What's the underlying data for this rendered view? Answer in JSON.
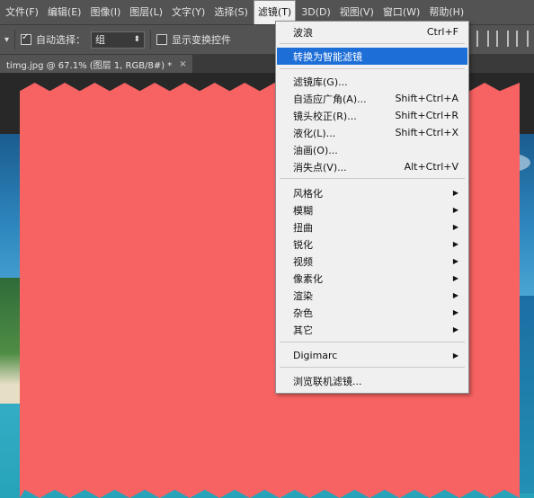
{
  "menubar": {
    "items": [
      {
        "label": "文件(F)"
      },
      {
        "label": "编辑(E)"
      },
      {
        "label": "图像(I)"
      },
      {
        "label": "图层(L)"
      },
      {
        "label": "文字(Y)"
      },
      {
        "label": "选择(S)"
      },
      {
        "label": "滤镜(T)"
      },
      {
        "label": "3D(D)"
      },
      {
        "label": "视图(V)"
      },
      {
        "label": "窗口(W)"
      },
      {
        "label": "帮助(H)"
      }
    ]
  },
  "options": {
    "auto_select_label": "自动选择：",
    "auto_select_value": "组",
    "show_transform_label": "显示变换控件"
  },
  "tab": {
    "title": "timg.jpg @ 67.1% (图层 1, RGB/8#) *",
    "close": "×"
  },
  "filter_menu": {
    "items": [
      {
        "label": "波浪",
        "shortcut": "Ctrl+F"
      },
      {
        "label": "转换为智能滤镜",
        "shortcut": ""
      },
      {
        "label": "滤镜库(G)...",
        "shortcut": ""
      },
      {
        "label": "自适应广角(A)...",
        "shortcut": "Shift+Ctrl+A"
      },
      {
        "label": "镜头校正(R)...",
        "shortcut": "Shift+Ctrl+R"
      },
      {
        "label": "液化(L)...",
        "shortcut": "Shift+Ctrl+X"
      },
      {
        "label": "油画(O)...",
        "shortcut": ""
      },
      {
        "label": "消失点(V)...",
        "shortcut": "Alt+Ctrl+V"
      },
      {
        "label": "风格化",
        "shortcut": ""
      },
      {
        "label": "模糊",
        "shortcut": ""
      },
      {
        "label": "扭曲",
        "shortcut": ""
      },
      {
        "label": "锐化",
        "shortcut": ""
      },
      {
        "label": "视频",
        "shortcut": ""
      },
      {
        "label": "像素化",
        "shortcut": ""
      },
      {
        "label": "渲染",
        "shortcut": ""
      },
      {
        "label": "杂色",
        "shortcut": ""
      },
      {
        "label": "其它",
        "shortcut": ""
      },
      {
        "label": "Digimarc",
        "shortcut": ""
      },
      {
        "label": "浏览联机滤镜...",
        "shortcut": ""
      }
    ]
  },
  "colors": {
    "highlight": "#1e6ed8",
    "mask": "#f76262"
  },
  "icons": {
    "submenu_arrow": "▶",
    "dropdown_arrow": "⬍",
    "tool_arrow": "▾"
  }
}
